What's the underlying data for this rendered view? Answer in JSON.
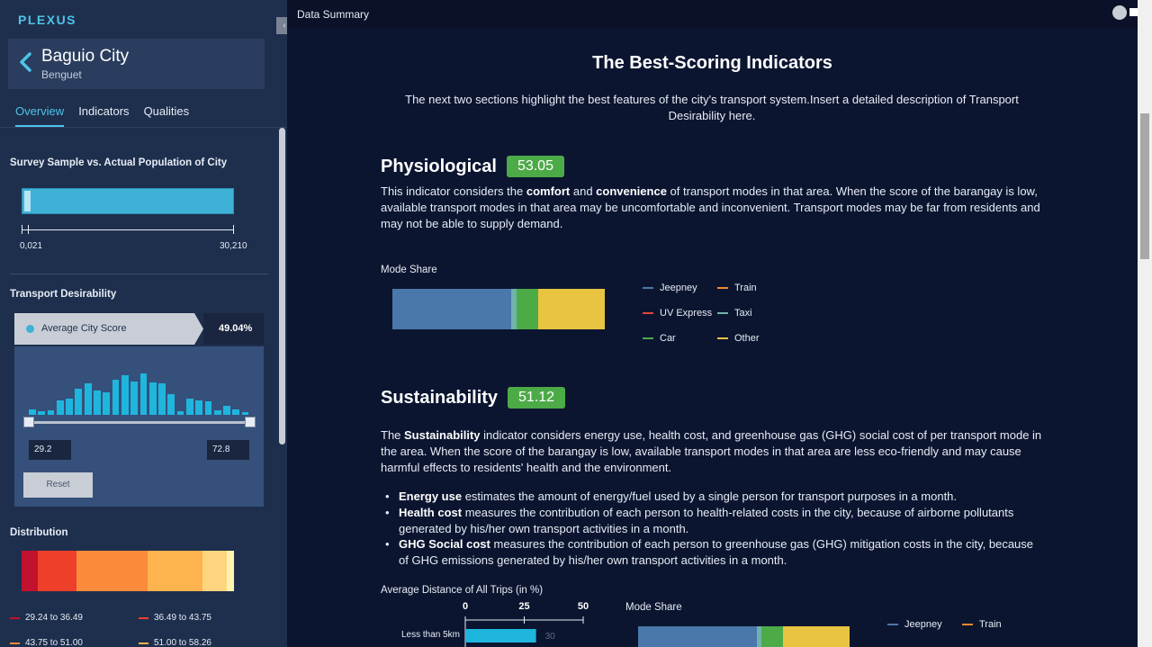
{
  "app": {
    "brand": "PLEXUS",
    "collapse_glyph": "‹"
  },
  "location": {
    "city": "Baguio City",
    "province": "Benguet"
  },
  "tabs": [
    {
      "label": "Overview",
      "active": true
    },
    {
      "label": "Indicators",
      "active": false
    },
    {
      "label": "Qualities",
      "active": false
    }
  ],
  "survey": {
    "title": "Survey Sample vs. Actual Population of City",
    "min_label": "0,021",
    "max_label": "30,210"
  },
  "desirability": {
    "title": "Transport Desirability",
    "score_label": "Average City Score",
    "score_value": "49.04%",
    "histogram": [
      0.12,
      0.08,
      0.1,
      0.3,
      0.35,
      0.55,
      0.68,
      0.52,
      0.48,
      0.75,
      0.85,
      0.72,
      0.88,
      0.7,
      0.68,
      0.45,
      0.08,
      0.35,
      0.3,
      0.28,
      0.1,
      0.2,
      0.12,
      0.06
    ],
    "range_min": "29.2",
    "range_max": "72.8",
    "reset_label": "Reset"
  },
  "distribution": {
    "title": "Distribution",
    "colors": [
      "#c1122e",
      "#ee3f2b",
      "#fb8a3b",
      "#fdb34e",
      "#fdd57e",
      "#fff4ad"
    ],
    "legend": [
      {
        "label": "29.24 to 36.49",
        "color": "#c1122e"
      },
      {
        "label": "36.49 to 43.75",
        "color": "#ee3f2b"
      },
      {
        "label": "43.75 to 51.00",
        "color": "#fb8a3b"
      },
      {
        "label": "51.00 to 58.26",
        "color": "#fdb34e"
      }
    ]
  },
  "header": {
    "title": "Data Summary"
  },
  "main": {
    "heading": "The Best-Scoring Indicators",
    "intro": "The next two sections highlight the best features of the city's transport system.Insert a detailed description of Transport Desirability here.",
    "physiological": {
      "name": "Physiological",
      "score": "53.05",
      "p1": "This indicator considers the ",
      "b1": "comfort",
      "p2": " and ",
      "b2": "convenience",
      "p3": " of transport modes in that area. When the score of the barangay is low, available transport modes in that area may be uncomfortable and inconvenient. Transport modes may be far from residents and may not be able to supply demand."
    },
    "sustainability": {
      "name": "Sustainability",
      "score": "51.12",
      "p1": "The ",
      "b1": "Sustainability",
      "p2": " indicator considers energy use, health cost, and greenhouse gas (GHG) social cost of per transport mode in the area. When the score of the barangay is low, available transport modes in that area are less eco-friendly and may cause harmful effects to residents' health and the environment.",
      "bullets": [
        {
          "term": "Energy use",
          "text": " estimates the amount of energy/fuel used by a single person for transport purposes in a month."
        },
        {
          "term": "Health cost",
          "text": " measures the contribution of each person to health-related costs in the city, because of airborne pollutants generated by his/her own transport activities in a month."
        },
        {
          "term": "GHG Social cost",
          "text": " measures the contribution of each person to greenhouse gas (GHG) mitigation costs in the city, because of GHG emissions generated by his/her own transport activities in a month."
        }
      ]
    }
  },
  "chart_data": [
    {
      "type": "bar",
      "title": "Mode Share",
      "orientation": "horizontal-stacked",
      "series": [
        {
          "name": "Jeepney",
          "value": 56,
          "color": "#4a78ab"
        },
        {
          "name": "Taxi",
          "value": 2.5,
          "color": "#6fb3ad"
        },
        {
          "name": "Car",
          "value": 10,
          "color": "#4caa47"
        },
        {
          "name": "Other",
          "value": 31.5,
          "color": "#e8c440"
        }
      ],
      "legend": [
        {
          "name": "Jeepney",
          "color": "#4a78ab"
        },
        {
          "name": "Train",
          "color": "#f08a2e"
        },
        {
          "name": "UV Express",
          "color": "#e0443a"
        },
        {
          "name": "Taxi",
          "color": "#6fb3ad"
        },
        {
          "name": "Car",
          "color": "#4caa47"
        },
        {
          "name": "Other",
          "color": "#e8c440"
        }
      ]
    },
    {
      "type": "bar",
      "title": "Average Distance of All Trips (in %)",
      "ticks": [
        "0",
        "25",
        "50"
      ],
      "xlim": [
        0,
        50
      ],
      "categories": [
        "Less than 5km"
      ],
      "values": [
        30
      ],
      "value_labels": [
        "30"
      ]
    },
    {
      "type": "bar",
      "title": "Mode Share",
      "orientation": "horizontal-stacked",
      "series": [
        {
          "name": "Jeepney",
          "value": 56,
          "color": "#4a78ab"
        },
        {
          "name": "Taxi",
          "value": 2.5,
          "color": "#6fb3ad"
        },
        {
          "name": "Car",
          "value": 10,
          "color": "#4caa47"
        },
        {
          "name": "Other",
          "value": 31.5,
          "color": "#e8c440"
        }
      ],
      "legend": [
        {
          "name": "Jeepney",
          "color": "#4a78ab"
        },
        {
          "name": "Train",
          "color": "#f08a2e"
        }
      ]
    }
  ]
}
